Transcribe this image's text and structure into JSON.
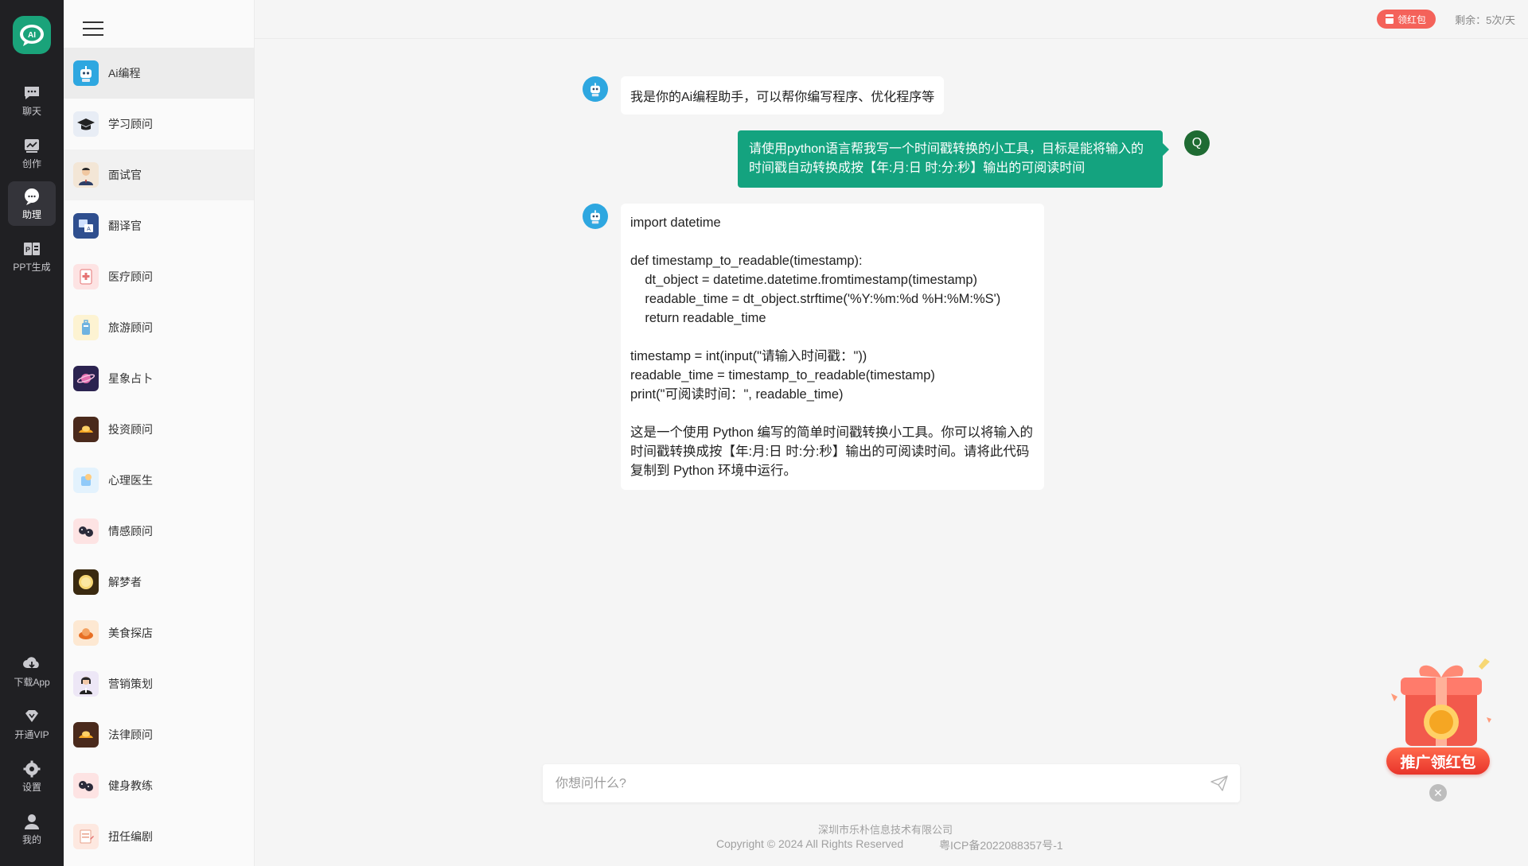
{
  "rail": {
    "items": [
      {
        "label": "聊天",
        "icon": "chat-icon"
      },
      {
        "label": "创作",
        "icon": "create-icon"
      },
      {
        "label": "助理",
        "icon": "assistant-icon"
      },
      {
        "label": "PPT生成",
        "icon": "ppt-icon"
      }
    ],
    "bottom": [
      {
        "label": "下载App",
        "icon": "download-icon"
      },
      {
        "label": "开通VIP",
        "icon": "vip-icon"
      },
      {
        "label": "设置",
        "icon": "settings-icon"
      },
      {
        "label": "我的",
        "icon": "user-icon"
      }
    ],
    "logo_text": "AI",
    "accent": "#1aa37a"
  },
  "assistants": [
    "Ai编程",
    "学习顾问",
    "面试官",
    "翻译官",
    "医疗顾问",
    "旅游顾问",
    "星象占卜",
    "投资顾问",
    "心理医生",
    "情感顾问",
    "解梦者",
    "美食探店",
    "营销策划",
    "法律顾问",
    "健身教练",
    "扭任编剧"
  ],
  "topbar": {
    "redpacket_label": "领红包",
    "remaining_text": "剩余：5次/天"
  },
  "chat": {
    "greeting": "我是你的Ai编程助手，可以帮你编写程序、优化程序等",
    "user_message": "请使用python语言帮我写一个时间戳转换的小工具，目标是能将输入的时间戳自动转换成按【年:月:日 时:分:秒】输出的可阅读时间",
    "user_avatar_letter": "Q",
    "reply_code": "import datetime\n\ndef timestamp_to_readable(timestamp):\n    dt_object = datetime.datetime.fromtimestamp(timestamp)\n    readable_time = dt_object.strftime('%Y:%m:%d %H:%M:%S')\n    return readable_time\n\ntimestamp = int(input(\"请输入时间戳：\"))\nreadable_time = timestamp_to_readable(timestamp)\nprint(\"可阅读时间：\", readable_time)",
    "reply_explanation": "这是一个使用 Python 编写的简单时间戳转换小工具。你可以将输入的时间戳转换成按【年:月:日 时:分:秒】输出的可阅读时间。请将此代码复制到 Python 环境中运行。",
    "user_bubble_color": "#14a37f"
  },
  "input": {
    "placeholder": "你想问什么?",
    "value": ""
  },
  "footer": {
    "company": "深圳市乐朴信息技术有限公司",
    "copyright": "Copyright © 2024 All Rights Reserved",
    "icp": "粤ICP备2022088357号-1"
  },
  "promo": {
    "label": "推广领红包"
  }
}
